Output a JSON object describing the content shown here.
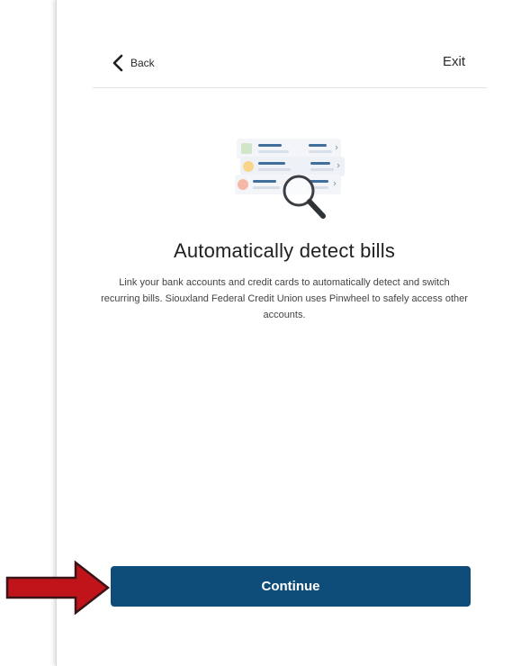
{
  "header": {
    "back_label": "Back",
    "exit_label": "Exit"
  },
  "illustration": {
    "icon": "bills-magnifier-icon"
  },
  "main": {
    "title": "Automatically detect bills",
    "description": "Link your bank accounts and credit cards to automatically detect and switch recurring bills. Siouxland Federal Credit Union uses Pinwheel to safely access other accounts."
  },
  "footer": {
    "continue_label": "Continue"
  },
  "annotation": {
    "icon": "right-arrow-icon"
  },
  "colors": {
    "primary_button": "#0e4d79",
    "annotation_arrow": "#c0141a"
  }
}
